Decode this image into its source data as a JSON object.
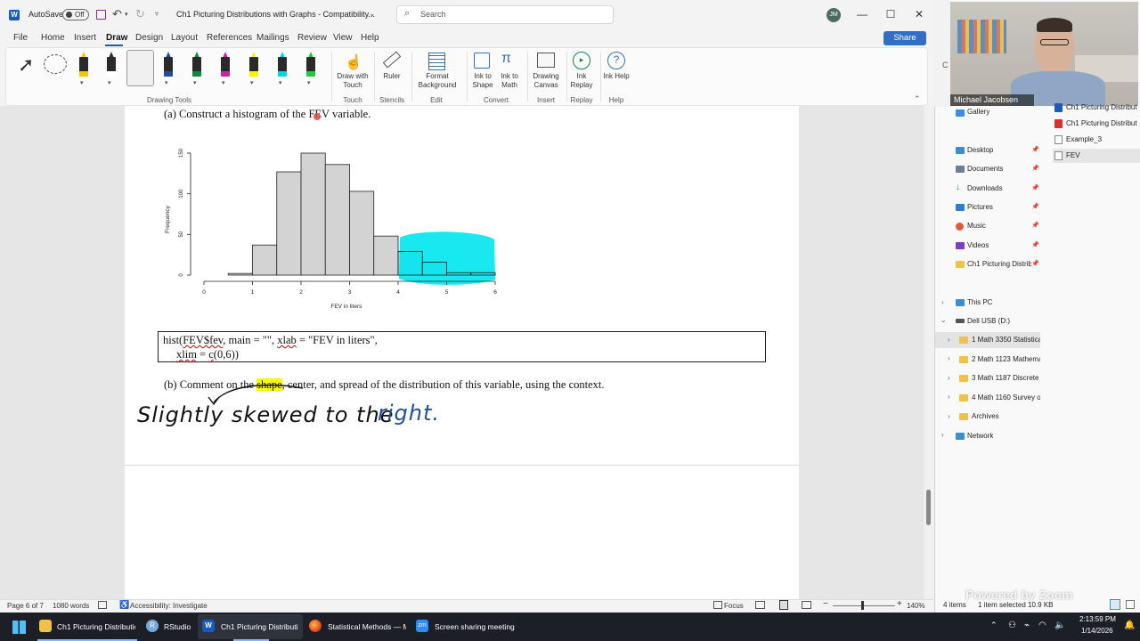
{
  "titlebar": {
    "autosave_label": "AutoSave",
    "autosave_state": "Off",
    "doc_title": "Ch1 Picturing Distributions with Graphs  -  Compatibility...",
    "search_placeholder": "Search",
    "avatar_initials": "JM"
  },
  "menu": {
    "items": [
      "File",
      "Home",
      "Insert",
      "Draw",
      "Design",
      "Layout",
      "References",
      "Mailings",
      "Review",
      "View",
      "Help"
    ],
    "active": "Draw",
    "share_label": "Share"
  },
  "ribbon": {
    "drawing_tools_label": "Drawing Tools",
    "pen_colors": [
      "#f2c500",
      "#ffffff",
      "#111111",
      "#1f4e9c",
      "#0b8a3a",
      "#c8259e",
      "#fff200",
      "#00d4e8",
      "#22c93e"
    ],
    "draw_with_touch": "Draw with Touch",
    "touch_group": "Touch",
    "ruler": "Ruler",
    "stencils_group": "Stencils",
    "format_background": "Format Background",
    "edit_group": "Edit",
    "ink_to_shape": "Ink to Shape",
    "ink_to_math": "Ink to Math",
    "convert_group": "Convert",
    "drawing_canvas": "Drawing Canvas",
    "insert_group": "Insert",
    "ink_replay": "Ink Replay",
    "replay_group": "Replay",
    "ink_help": "Ink Help",
    "help_group": "Help"
  },
  "document": {
    "part_a": "(a)  Construct a histogram of the FEV variable.",
    "code_line1_a": "hist(",
    "code_line1_b": "FEV$fev",
    "code_line1_c": ", main = \"\", ",
    "code_line1_d": "xlab",
    "code_line1_e": " = \"FEV in liters\",",
    "code_line2_a": "xlim",
    "code_line2_b": " = ",
    "code_line2_c": "c",
    "code_line2_d": "(0,6))",
    "part_b_1": "(b)  Comment on the ",
    "part_b_shape": "shape",
    "part_b_2": ", center, and spread of the distribution of this variable, using the context.",
    "handwriting_black": "Slightly skewed to the",
    "handwriting_blue": "right."
  },
  "chart_data": {
    "type": "bar",
    "xlabel": "FEV in liters",
    "ylabel": "Frequency",
    "xlim": [
      0,
      6
    ],
    "ylim": [
      0,
      150
    ],
    "x_ticks": [
      "0",
      "1",
      "2",
      "3",
      "4",
      "5",
      "6"
    ],
    "y_ticks": [
      "0",
      "50",
      "100",
      "150"
    ],
    "bin_edges": [
      0.5,
      1.0,
      1.5,
      2.0,
      2.5,
      3.0,
      3.5,
      4.0,
      4.5,
      5.0,
      5.5,
      6.0
    ],
    "values": [
      2,
      37,
      127,
      150,
      136,
      103,
      48,
      29,
      16,
      3,
      3
    ],
    "highlight_color": "#00e5ee"
  },
  "status": {
    "page": "Page 6 of 7",
    "words": "1080 words",
    "accessibility": "Accessibility: Investigate",
    "focus": "Focus",
    "zoom": "140%"
  },
  "explorer": {
    "webcam_name": "Michael Jacobsen",
    "recent_files": [
      "Ch1  Picturing Distribut",
      "Ch1  Picturing Distribut",
      "Example_3",
      "FEV"
    ],
    "gallery": "Gallery",
    "quick_access": [
      "Desktop",
      "Documents",
      "Downloads",
      "Pictures",
      "Music",
      "Videos",
      "Ch1 Picturing Distrib"
    ],
    "this_pc": "This PC",
    "usb": "Dell USB (D:)",
    "folders": [
      "1 Math 3350 Statistical",
      "2 Math 1123 Mathema",
      "3 Math 1187 Discrete M",
      "4 Math 1160 Survey of",
      "Archives"
    ],
    "network": "Network",
    "items_count": "4 items",
    "selected": "1 item selected  10.9 KB",
    "watermark": "Powered by Zoom"
  },
  "taskbar": {
    "items": [
      "Ch1 Picturing Distributio",
      "RStudio",
      "Ch1  Picturing Distributi",
      "Statistical Methods — M",
      "Screen sharing meeting"
    ],
    "time": "2:13:59 PM",
    "date": "1/14/2026"
  }
}
